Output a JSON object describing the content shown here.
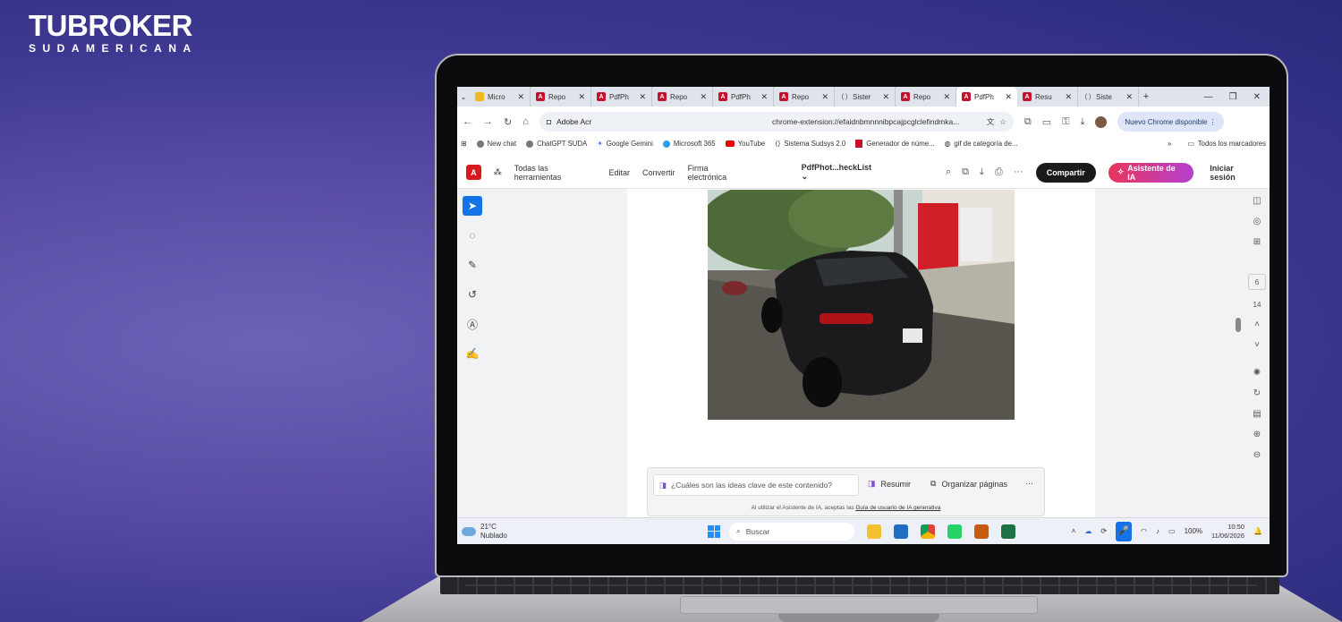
{
  "brand": {
    "name": "TUBROKER",
    "sub": "SUDAMERICANA"
  },
  "browser": {
    "tabs": [
      {
        "label": "Micro",
        "icon": "ms"
      },
      {
        "label": "Repo",
        "icon": "pdf"
      },
      {
        "label": "PdfPh",
        "icon": "pdf"
      },
      {
        "label": "Repo",
        "icon": "pdf"
      },
      {
        "label": "PdfPh",
        "icon": "pdf"
      },
      {
        "label": "Repo",
        "icon": "pdf"
      },
      {
        "label": "Sister",
        "icon": "bracket"
      },
      {
        "label": "Repo",
        "icon": "pdf"
      },
      {
        "label": "PdfPh",
        "icon": "pdf",
        "active": true
      },
      {
        "label": "Resu",
        "icon": "pdf"
      },
      {
        "label": "Siste",
        "icon": "bracket"
      }
    ],
    "address_site": "Adobe Acr",
    "url": "chrome-extension://efaidnbmnnnibpcajpcglclefindmka...",
    "chrome_update": "Nuevo Chrome disponible",
    "bookmarks": [
      "New chat",
      "ChatGPT SUDA",
      "Google Gemini",
      "Microsoft 365",
      "YouTube",
      "Sistema Sudsys 2.0",
      "Generador de núme...",
      "gif de categoría de..."
    ],
    "bookmarks_more": "»",
    "all_bookmarks": "Todos los marcadores"
  },
  "acrobat": {
    "menu": [
      "Todas las herramientas",
      "Editar",
      "Convertir",
      "Firma electrónica"
    ],
    "doc_title": "PdfPhot...heckList",
    "share": "Compartir",
    "ai_button": "Asistente de IA",
    "signin": "Iniciar sesión",
    "page_current": "6",
    "page_total": "14"
  },
  "ai_bar": {
    "placeholder": "¿Cuáles son las ideas clave de este contenido?",
    "summarize": "Resumir",
    "organize": "Organizar páginas",
    "more": "···",
    "disclaimer_prefix": "Al utilizar el Asistente de IA, aceptas las ",
    "disclaimer_link": "Guía de usuario de IA generativa"
  },
  "taskbar": {
    "temp": "21°C",
    "weather": "Nublado",
    "search": "Buscar",
    "battery": "100%",
    "time": "10:50",
    "date": "11/06/2026"
  }
}
